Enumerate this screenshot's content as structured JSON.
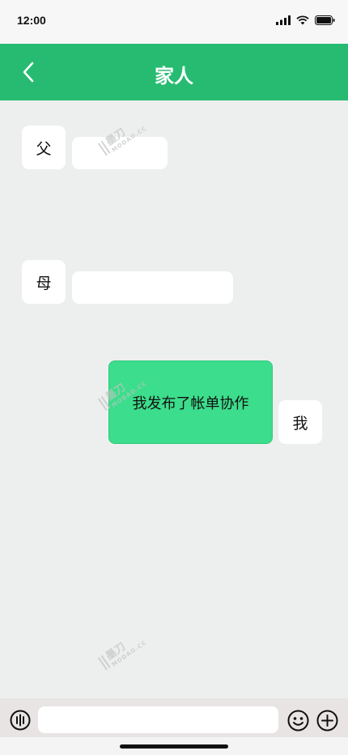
{
  "status_bar": {
    "time": "12:00",
    "icons": [
      "signal-icon",
      "wifi-icon",
      "battery-icon"
    ]
  },
  "header": {
    "title": "家人",
    "back_icon": "chevron-left-icon",
    "background": "#27bb72"
  },
  "messages": [
    {
      "sender": "父",
      "text": "",
      "side": "left"
    },
    {
      "sender": "母",
      "text": "",
      "side": "left"
    },
    {
      "sender": "我",
      "text": "我发布了帐单协作",
      "side": "right"
    }
  ],
  "input_bar": {
    "placeholder": "",
    "left_icon": "voice-icon",
    "right_icons": [
      "emoji-icon",
      "plus-icon"
    ]
  },
  "watermark": {
    "brand": "墨刀",
    "sub": "MODAO.CC"
  },
  "colors": {
    "accent": "#27bb72",
    "my_bubble": "#3cdd8c",
    "background": "#edefee"
  }
}
